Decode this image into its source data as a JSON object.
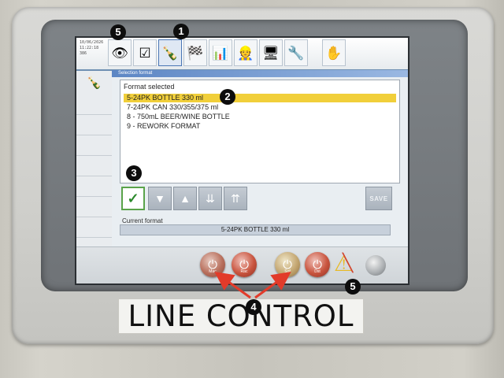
{
  "screen": {
    "datetime": [
      "10/06/2026",
      "11:22:18",
      "386"
    ],
    "toolbar_icons": [
      {
        "name": "eye-icon",
        "glyph": "👁"
      },
      {
        "name": "checklist-icon",
        "glyph": "☑"
      },
      {
        "name": "bottle-hand-icon",
        "glyph": "🍾"
      },
      {
        "name": "checkered-flags-icon",
        "glyph": "🏁"
      },
      {
        "name": "bar-chart-icon",
        "glyph": "📊"
      },
      {
        "name": "worker-icon",
        "glyph": "👷"
      },
      {
        "name": "monitor-icon",
        "glyph": "🖥"
      },
      {
        "name": "tools-icon",
        "glyph": "🔧"
      },
      {
        "name": "hand-icon",
        "glyph": "✋"
      }
    ],
    "window_title": "Selection format",
    "list_header": "Format selected",
    "formats": [
      "5-24PK BOTTLE 330 ml",
      "7-24PK CAN 330/355/375 ml",
      "8 - 750mL BEER/WINE BOTTLE",
      "9 - REWORK FORMAT"
    ],
    "selected_index": 0,
    "controls": {
      "ok_glyph": "✓",
      "down_glyph": "▼",
      "up_glyph": "▲",
      "down_all_glyph": "⇊",
      "up_all_glyph": "⇈",
      "save_label": "SAVE"
    },
    "current_format_label": "Current format",
    "current_format_value": "5-24PK BOTTLE 330 ml",
    "bottom_buttons": [
      {
        "label": "Mac"
      },
      {
        "label": "Rac"
      },
      {
        "label": "Sof"
      },
      {
        "label": "Dst"
      }
    ]
  },
  "plate_text": "LINE CONTROL",
  "annotations": [
    "1",
    "2",
    "3",
    "4",
    "5",
    "5"
  ],
  "colors": {
    "selection": "#f1cf3a",
    "arrow": "#e23b2a"
  }
}
